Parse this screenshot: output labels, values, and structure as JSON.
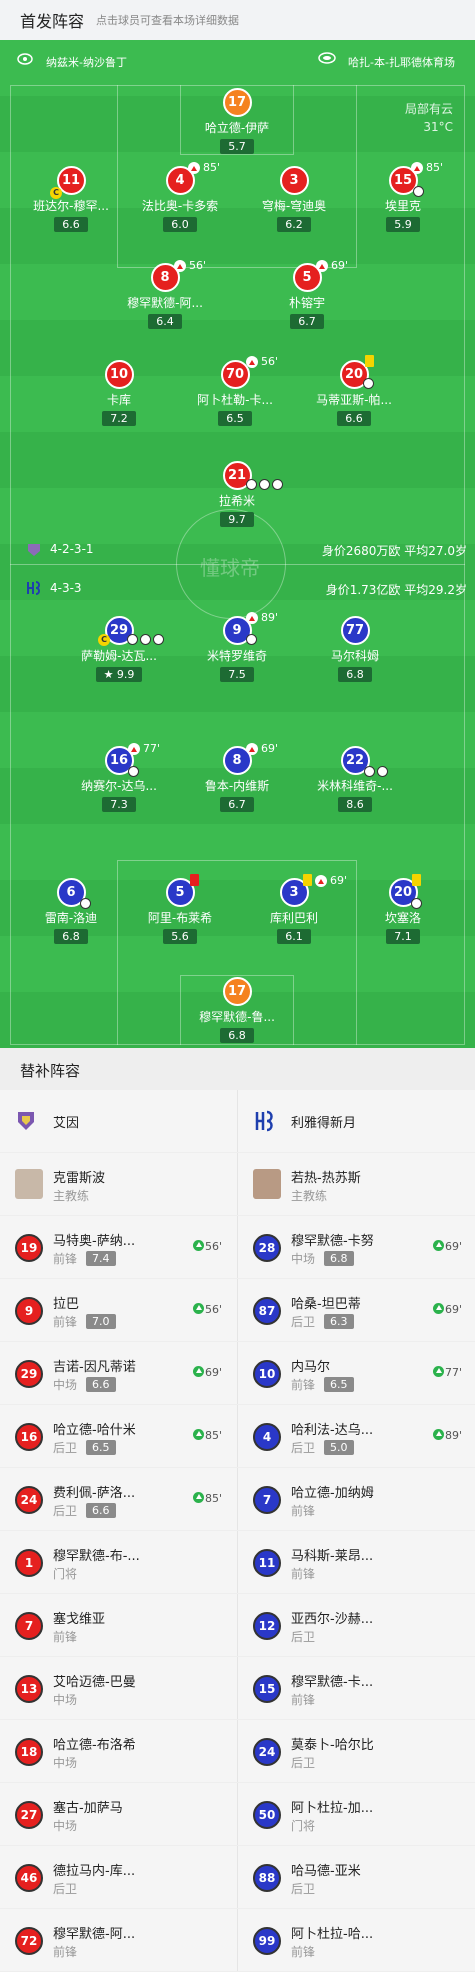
{
  "header": {
    "title": "首发阵容",
    "subtitle": "点击球员可查看本场详细数据"
  },
  "pitch": {
    "home_venue": "纳兹米-纳沙鲁丁",
    "away_venue": "哈扎-本-扎耶德体育场",
    "weather": "局部有云",
    "temperature": "31°C",
    "watermark": "懂球帝",
    "home_formation": "4-2-3-1",
    "home_value": "身价2680万欧",
    "home_age": "平均27.0岁",
    "away_formation": "4-3-3",
    "away_value": "身价1.73亿欧",
    "away_age": "平均29.2岁"
  },
  "home_players": [
    {
      "num": "17",
      "name": "哈立德-伊萨",
      "rating": "5.7"
    },
    {
      "num": "11",
      "name": "班达尔-穆罕...",
      "rating": "6.6"
    },
    {
      "num": "4",
      "name": "法比奥-卡多索",
      "rating": "6.0",
      "sub": "85'"
    },
    {
      "num": "3",
      "name": "穹梅-穹迪奥",
      "rating": "6.2"
    },
    {
      "num": "15",
      "name": "埃里克",
      "rating": "5.9",
      "sub": "85'"
    },
    {
      "num": "8",
      "name": "穆罕默德-阿...",
      "rating": "6.4",
      "sub": "56'"
    },
    {
      "num": "5",
      "name": "朴镕宇",
      "rating": "6.7",
      "sub": "69'"
    },
    {
      "num": "10",
      "name": "卡库",
      "rating": "7.2"
    },
    {
      "num": "70",
      "name": "阿卜杜勒-卡...",
      "rating": "6.5",
      "sub": "56'"
    },
    {
      "num": "20",
      "name": "马蒂亚斯-帕...",
      "rating": "6.6"
    },
    {
      "num": "21",
      "name": "拉希米",
      "rating": "9.7"
    }
  ],
  "away_players": [
    {
      "num": "29",
      "name": "萨勒姆-达瓦...",
      "rating": "9.9"
    },
    {
      "num": "9",
      "name": "米特罗维奇",
      "rating": "7.5",
      "sub": "89'"
    },
    {
      "num": "77",
      "name": "马尔科姆",
      "rating": "6.8"
    },
    {
      "num": "16",
      "name": "纳赛尔-达乌...",
      "rating": "7.3",
      "sub": "77'"
    },
    {
      "num": "8",
      "name": "鲁本-内维斯",
      "rating": "6.7",
      "sub": "69'"
    },
    {
      "num": "22",
      "name": "米林科维奇-...",
      "rating": "8.6"
    },
    {
      "num": "6",
      "name": "雷南-洛迪",
      "rating": "6.8"
    },
    {
      "num": "5",
      "name": "阿里-布莱希",
      "rating": "5.6"
    },
    {
      "num": "3",
      "name": "库利巴利",
      "rating": "6.1",
      "sub": "69'"
    },
    {
      "num": "20",
      "name": "坎塞洛",
      "rating": "7.1"
    },
    {
      "num": "17",
      "name": "穆罕默德-鲁...",
      "rating": "6.8"
    }
  ],
  "subs_header": "替补阵容",
  "subs": {
    "home_team": "艾因",
    "away_team": "利雅得新月",
    "home_coach": {
      "name": "克雷斯波",
      "role": "主教练"
    },
    "away_coach": {
      "name": "若热-热苏斯",
      "role": "主教练"
    },
    "home": [
      {
        "num": "19",
        "name": "马特奥-萨纳...",
        "pos": "前锋",
        "rating": "7.4",
        "in": "56'"
      },
      {
        "num": "9",
        "name": "拉巴",
        "pos": "前锋",
        "rating": "7.0",
        "in": "56'"
      },
      {
        "num": "29",
        "name": "吉诺-因凡蒂诺",
        "pos": "中场",
        "rating": "6.6",
        "in": "69'"
      },
      {
        "num": "16",
        "name": "哈立德-哈什米",
        "pos": "后卫",
        "rating": "6.5",
        "in": "85'"
      },
      {
        "num": "24",
        "name": "费利佩-萨洛...",
        "pos": "后卫",
        "rating": "6.6",
        "in": "85'"
      },
      {
        "num": "1",
        "name": "穆罕默德-布-...",
        "pos": "门将"
      },
      {
        "num": "7",
        "name": "塞戈维亚",
        "pos": "前锋"
      },
      {
        "num": "13",
        "name": "艾哈迈德-巴曼",
        "pos": "中场"
      },
      {
        "num": "18",
        "name": "哈立德-布洛希",
        "pos": "中场"
      },
      {
        "num": "27",
        "name": "塞古-加萨马",
        "pos": "中场"
      },
      {
        "num": "46",
        "name": "德拉马内-库...",
        "pos": "后卫"
      },
      {
        "num": "72",
        "name": "穆罕默德-阿...",
        "pos": "前锋"
      }
    ],
    "away": [
      {
        "num": "28",
        "name": "穆罕默德-卡努",
        "pos": "中场",
        "rating": "6.8",
        "in": "69'"
      },
      {
        "num": "87",
        "name": "哈桑-坦巴蒂",
        "pos": "后卫",
        "rating": "6.3",
        "in": "69'"
      },
      {
        "num": "10",
        "name": "内马尔",
        "pos": "前锋",
        "rating": "6.5",
        "in": "77'"
      },
      {
        "num": "4",
        "name": "哈利法-达乌...",
        "pos": "后卫",
        "rating": "5.0",
        "in": "89'"
      },
      {
        "num": "7",
        "name": "哈立德-加纳姆",
        "pos": "前锋"
      },
      {
        "num": "11",
        "name": "马科斯-莱昂...",
        "pos": "前锋"
      },
      {
        "num": "12",
        "name": "亚西尔-沙赫...",
        "pos": "后卫"
      },
      {
        "num": "15",
        "name": "穆罕默德-卡...",
        "pos": "前锋"
      },
      {
        "num": "24",
        "name": "莫泰卜-哈尔比",
        "pos": "后卫"
      },
      {
        "num": "50",
        "name": "阿卜杜拉-加...",
        "pos": "门将"
      },
      {
        "num": "88",
        "name": "哈马德-亚米",
        "pos": "后卫"
      },
      {
        "num": "99",
        "name": "阿卜杜拉-哈...",
        "pos": "前锋"
      }
    ]
  }
}
